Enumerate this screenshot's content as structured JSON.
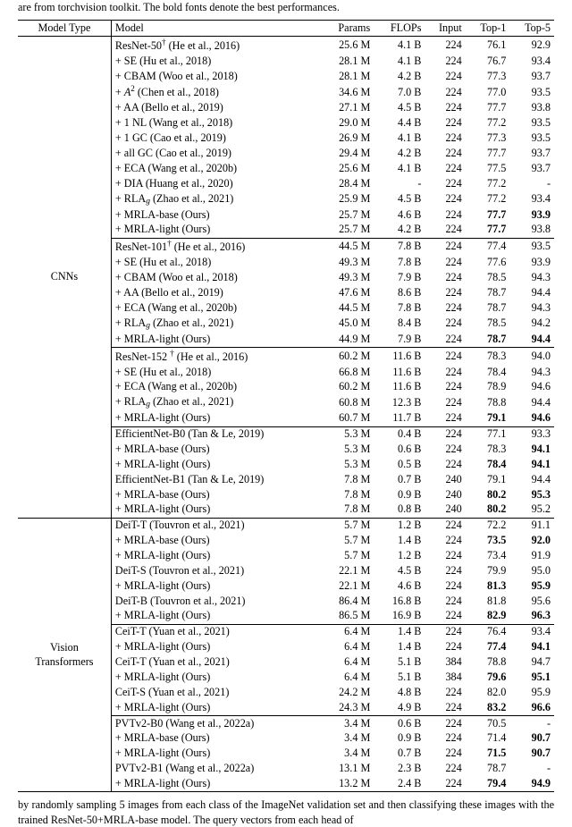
{
  "fragment_top": "are from torchvision toolkit. The bold fonts denote the best performances.",
  "headers": {
    "model_type": "Model Type",
    "model": "Model",
    "params": "Params",
    "flops": "FLOPs",
    "input": "Input",
    "top1": "Top-1",
    "top5": "Top-5"
  },
  "types": {
    "cnn": "CNNs",
    "vit": "Vision\nTransformers"
  },
  "groups": [
    [
      {
        "m": "ResNet-50† (He et al., 2016)",
        "p": "25.6 M",
        "f": "4.1 B",
        "i": "224",
        "t1": "76.1",
        "t5": "92.9"
      },
      {
        "m": "+ SE (Hu et al., 2018)",
        "p": "28.1 M",
        "f": "4.1 B",
        "i": "224",
        "t1": "76.7",
        "t5": "93.4"
      },
      {
        "m": "+ CBAM (Woo et al., 2018)",
        "p": "28.1 M",
        "f": "4.2 B",
        "i": "224",
        "t1": "77.3",
        "t5": "93.7"
      },
      {
        "m": "+ A² (Chen et al., 2018)",
        "p": "34.6 M",
        "f": "7.0 B",
        "i": "224",
        "t1": "77.0",
        "t5": "93.5"
      },
      {
        "m": "+ AA (Bello et al., 2019)",
        "p": "27.1 M",
        "f": "4.5 B",
        "i": "224",
        "t1": "77.7",
        "t5": "93.8"
      },
      {
        "m": "+ 1 NL (Wang et al., 2018)",
        "p": "29.0 M",
        "f": "4.4 B",
        "i": "224",
        "t1": "77.2",
        "t5": "93.5"
      },
      {
        "m": "+ 1 GC (Cao et al., 2019)",
        "p": "26.9 M",
        "f": "4.1 B",
        "i": "224",
        "t1": "77.3",
        "t5": "93.5"
      },
      {
        "m": "+ all GC (Cao et al., 2019)",
        "p": "29.4 M",
        "f": "4.2 B",
        "i": "224",
        "t1": "77.7",
        "t5": "93.7"
      },
      {
        "m": "+ ECA (Wang et al., 2020b)",
        "p": "25.6 M",
        "f": "4.1 B",
        "i": "224",
        "t1": "77.5",
        "t5": "93.7"
      },
      {
        "m": "+ DIA (Huang et al., 2020)",
        "p": "28.4 M",
        "f": "-",
        "i": "224",
        "t1": "77.2",
        "t5": "-"
      },
      {
        "m": "+ RLA_g (Zhao et al., 2021)",
        "p": "25.9 M",
        "f": "4.5 B",
        "i": "224",
        "t1": "77.2",
        "t5": "93.4"
      },
      {
        "m": "+ MRLA-base (Ours)",
        "p": "25.7 M",
        "f": "4.6 B",
        "i": "224",
        "t1": "77.7",
        "t5": "93.9",
        "b1": true,
        "b5": true
      },
      {
        "m": "+ MRLA-light (Ours)",
        "p": "25.7 M",
        "f": "4.2 B",
        "i": "224",
        "t1": "77.7",
        "t5": "93.8",
        "b1": true
      }
    ],
    [
      {
        "m": "ResNet-101† (He et al., 2016)",
        "p": "44.5 M",
        "f": "7.8 B",
        "i": "224",
        "t1": "77.4",
        "t5": "93.5"
      },
      {
        "m": "+ SE (Hu et al., 2018)",
        "p": "49.3 M",
        "f": "7.8 B",
        "i": "224",
        "t1": "77.6",
        "t5": "93.9"
      },
      {
        "m": "+ CBAM (Woo et al., 2018)",
        "p": "49.3 M",
        "f": "7.9 B",
        "i": "224",
        "t1": "78.5",
        "t5": "94.3"
      },
      {
        "m": "+ AA (Bello et al., 2019)",
        "p": "47.6 M",
        "f": "8.6 B",
        "i": "224",
        "t1": "78.7",
        "t5": "94.4"
      },
      {
        "m": "+ ECA (Wang et al., 2020b)",
        "p": "44.5 M",
        "f": "7.8 B",
        "i": "224",
        "t1": "78.7",
        "t5": "94.3"
      },
      {
        "m": "+ RLA_g (Zhao et al., 2021)",
        "p": "45.0 M",
        "f": "8.4 B",
        "i": "224",
        "t1": "78.5",
        "t5": "94.2"
      },
      {
        "m": "+ MRLA-light (Ours)",
        "p": "44.9 M",
        "f": "7.9 B",
        "i": "224",
        "t1": "78.7",
        "t5": "94.4",
        "b1": true,
        "b5": true
      }
    ],
    [
      {
        "m": "ResNet-152 † (He et al., 2016)",
        "p": "60.2 M",
        "f": "11.6 B",
        "i": "224",
        "t1": "78.3",
        "t5": "94.0"
      },
      {
        "m": "+ SE (Hu et al., 2018)",
        "p": "66.8 M",
        "f": "11.6 B",
        "i": "224",
        "t1": "78.4",
        "t5": "94.3"
      },
      {
        "m": "+ ECA (Wang et al., 2020b)",
        "p": "60.2 M",
        "f": "11.6 B",
        "i": "224",
        "t1": "78.9",
        "t5": "94.6"
      },
      {
        "m": "+ RLA_g (Zhao et al., 2021)",
        "p": "60.8 M",
        "f": "12.3 B",
        "i": "224",
        "t1": "78.8",
        "t5": "94.4"
      },
      {
        "m": "+ MRLA-light (Ours)",
        "p": "60.7 M",
        "f": "11.7 B",
        "i": "224",
        "t1": "79.1",
        "t5": "94.6",
        "b1": true,
        "b5": true
      }
    ],
    [
      {
        "m": "EfficientNet-B0 (Tan & Le, 2019)",
        "p": "5.3 M",
        "f": "0.4 B",
        "i": "224",
        "t1": "77.1",
        "t5": "93.3"
      },
      {
        "m": "+ MRLA-base (Ours)",
        "p": "5.3 M",
        "f": "0.6 B",
        "i": "224",
        "t1": "78.3",
        "t5": "94.1",
        "b5": true
      },
      {
        "m": "+ MRLA-light (Ours)",
        "p": "5.3 M",
        "f": "0.5 B",
        "i": "224",
        "t1": "78.4",
        "t5": "94.1",
        "b1": true,
        "b5": true
      },
      {
        "m": "EfficientNet-B1 (Tan & Le, 2019)",
        "p": "7.8 M",
        "f": "0.7 B",
        "i": "240",
        "t1": "79.1",
        "t5": "94.4"
      },
      {
        "m": "+ MRLA-base (Ours)",
        "p": "7.8 M",
        "f": "0.9 B",
        "i": "240",
        "t1": "80.2",
        "t5": "95.3",
        "b1": true,
        "b5": true
      },
      {
        "m": "+ MRLA-light (Ours)",
        "p": "7.8 M",
        "f": "0.8 B",
        "i": "240",
        "t1": "80.2",
        "t5": "95.2",
        "b1": true
      }
    ],
    [
      {
        "m": "DeiT-T (Touvron et al., 2021)",
        "p": "5.7 M",
        "f": "1.2 B",
        "i": "224",
        "t1": "72.2",
        "t5": "91.1"
      },
      {
        "m": "+ MRLA-base (Ours)",
        "p": "5.7 M",
        "f": "1.4 B",
        "i": "224",
        "t1": "73.5",
        "t5": "92.0",
        "b1": true,
        "b5": true
      },
      {
        "m": "+ MRLA-light (Ours)",
        "p": "5.7 M",
        "f": "1.2 B",
        "i": "224",
        "t1": "73.4",
        "t5": "91.9"
      },
      {
        "m": "DeiT-S (Touvron et al., 2021)",
        "p": "22.1 M",
        "f": "4.5 B",
        "i": "224",
        "t1": "79.9",
        "t5": "95.0"
      },
      {
        "m": "+ MRLA-light (Ours)",
        "p": "22.1 M",
        "f": "4.6 B",
        "i": "224",
        "t1": "81.3",
        "t5": "95.9",
        "b1": true,
        "b5": true
      },
      {
        "m": "DeiT-B (Touvron et al., 2021)",
        "p": "86.4 M",
        "f": "16.8 B",
        "i": "224",
        "t1": "81.8",
        "t5": "95.6"
      },
      {
        "m": "+ MRLA-light (Ours)",
        "p": "86.5 M",
        "f": "16.9 B",
        "i": "224",
        "t1": "82.9",
        "t5": "96.3",
        "b1": true,
        "b5": true
      }
    ],
    [
      {
        "m": "CeiT-T (Yuan et al., 2021)",
        "p": "6.4 M",
        "f": "1.4 B",
        "i": "224",
        "t1": "76.4",
        "t5": "93.4"
      },
      {
        "m": "+ MRLA-light (Ours)",
        "p": "6.4 M",
        "f": "1.4 B",
        "i": "224",
        "t1": "77.4",
        "t5": "94.1",
        "b1": true,
        "b5": true
      },
      {
        "m": "CeiT-T (Yuan et al., 2021)",
        "p": "6.4 M",
        "f": "5.1 B",
        "i": "384",
        "t1": "78.8",
        "t5": "94.7"
      },
      {
        "m": "+ MRLA-light (Ours)",
        "p": "6.4 M",
        "f": "5.1 B",
        "i": "384",
        "t1": "79.6",
        "t5": "95.1",
        "b1": true,
        "b5": true
      },
      {
        "m": "CeiT-S (Yuan et al., 2021)",
        "p": "24.2 M",
        "f": "4.8 B",
        "i": "224",
        "t1": "82.0",
        "t5": "95.9"
      },
      {
        "m": "+ MRLA-light (Ours)",
        "p": "24.3 M",
        "f": "4.9 B",
        "i": "224",
        "t1": "83.2",
        "t5": "96.6",
        "b1": true,
        "b5": true
      }
    ],
    [
      {
        "m": "PVTv2-B0 (Wang et al., 2022a)",
        "p": "3.4 M",
        "f": "0.6 B",
        "i": "224",
        "t1": "70.5",
        "t5": "-"
      },
      {
        "m": "+ MRLA-base (Ours)",
        "p": "3.4 M",
        "f": "0.9 B",
        "i": "224",
        "t1": "71.4",
        "t5": "90.7",
        "b5": true
      },
      {
        "m": "+ MRLA-light (Ours)",
        "p": "3.4 M",
        "f": "0.7 B",
        "i": "224",
        "t1": "71.5",
        "t5": "90.7",
        "b1": true,
        "b5": true
      },
      {
        "m": "PVTv2-B1 (Wang et al., 2022a)",
        "p": "13.1 M",
        "f": "2.3 B",
        "i": "224",
        "t1": "78.7",
        "t5": "-"
      },
      {
        "m": "+ MRLA-light (Ours)",
        "p": "13.2 M",
        "f": "2.4 B",
        "i": "224",
        "t1": "79.4",
        "t5": "94.9",
        "b1": true,
        "b5": true
      }
    ]
  ],
  "fragment_bottom": "by randomly sampling 5 images from each class of the ImageNet validation set and then classifying these images with the trained ResNet-50+MRLA-base model. The query vectors from each head of"
}
